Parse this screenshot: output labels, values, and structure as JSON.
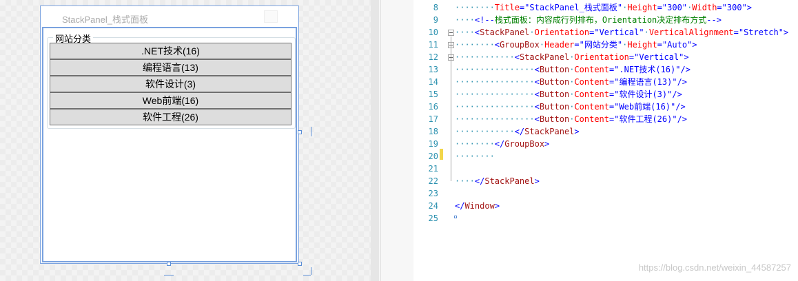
{
  "designer": {
    "window_title": "StackPanel_栈式面板",
    "group_header": "网站分类",
    "buttons": [
      ".NET技术(16)",
      "编程语言(13)",
      "软件设计(3)",
      "Web前端(16)",
      "软件工程(26)"
    ]
  },
  "editor": {
    "lines": [
      {
        "num": "8",
        "fold": "",
        "indent": "········",
        "parts": [
          [
            "attr",
            "Title"
          ],
          [
            "bracket",
            "=\""
          ],
          [
            "val",
            "StackPanel_栈式面板"
          ],
          [
            "bracket",
            "\""
          ],
          [
            "dots",
            "·"
          ],
          [
            "attr",
            "Height"
          ],
          [
            "bracket",
            "=\""
          ],
          [
            "val",
            "300"
          ],
          [
            "bracket",
            "\""
          ],
          [
            "dots",
            "·"
          ],
          [
            "attr",
            "Width"
          ],
          [
            "bracket",
            "=\""
          ],
          [
            "val",
            "300"
          ],
          [
            "bracket",
            "\">"
          ]
        ]
      },
      {
        "num": "9",
        "fold": "",
        "indent": "····",
        "parts": [
          [
            "bracket",
            "<!--"
          ],
          [
            "comment",
            "栈式面板：内容成行列排布，Orientation决定排布方式"
          ],
          [
            "bracket",
            "-->"
          ]
        ]
      },
      {
        "num": "10",
        "fold": "-",
        "indent": "····",
        "parts": [
          [
            "bracket",
            "<"
          ],
          [
            "tag",
            "StackPanel"
          ],
          [
            "dots",
            "·"
          ],
          [
            "attr",
            "Orientation"
          ],
          [
            "bracket",
            "=\""
          ],
          [
            "val",
            "Vertical"
          ],
          [
            "bracket",
            "\""
          ],
          [
            "dots",
            "·"
          ],
          [
            "attr",
            "VerticalAlignment"
          ],
          [
            "bracket",
            "=\""
          ],
          [
            "val",
            "Stretch"
          ],
          [
            "bracket",
            "\">"
          ]
        ]
      },
      {
        "num": "11",
        "fold": "-",
        "indent": "········",
        "parts": [
          [
            "bracket",
            "<"
          ],
          [
            "tag",
            "GroupBox"
          ],
          [
            "dots",
            "·"
          ],
          [
            "attr",
            "Header"
          ],
          [
            "bracket",
            "=\""
          ],
          [
            "val",
            "网站分类"
          ],
          [
            "bracket",
            "\""
          ],
          [
            "dots",
            "·"
          ],
          [
            "attr",
            "Height"
          ],
          [
            "bracket",
            "=\""
          ],
          [
            "val",
            "Auto"
          ],
          [
            "bracket",
            "\">"
          ]
        ]
      },
      {
        "num": "12",
        "fold": "-",
        "indent": "············",
        "parts": [
          [
            "bracket",
            "<"
          ],
          [
            "tag",
            "StackPanel"
          ],
          [
            "dots",
            "·"
          ],
          [
            "attr",
            "Orientation"
          ],
          [
            "bracket",
            "=\""
          ],
          [
            "val",
            "Vertical"
          ],
          [
            "bracket",
            "\">"
          ]
        ]
      },
      {
        "num": "13",
        "fold": "",
        "indent": "················",
        "parts": [
          [
            "bracket",
            "<"
          ],
          [
            "tag",
            "Button"
          ],
          [
            "dots",
            "·"
          ],
          [
            "attr",
            "Content"
          ],
          [
            "bracket",
            "=\""
          ],
          [
            "val",
            ".NET技术(16)"
          ],
          [
            "bracket",
            "\"/>"
          ]
        ]
      },
      {
        "num": "14",
        "fold": "",
        "indent": "················",
        "parts": [
          [
            "bracket",
            "<"
          ],
          [
            "tag",
            "Button"
          ],
          [
            "dots",
            "·"
          ],
          [
            "attr",
            "Content"
          ],
          [
            "bracket",
            "=\""
          ],
          [
            "val",
            "编程语言(13)"
          ],
          [
            "bracket",
            "\"/>"
          ]
        ]
      },
      {
        "num": "15",
        "fold": "",
        "indent": "················",
        "parts": [
          [
            "bracket",
            "<"
          ],
          [
            "tag",
            "Button"
          ],
          [
            "dots",
            "·"
          ],
          [
            "attr",
            "Content"
          ],
          [
            "bracket",
            "=\""
          ],
          [
            "val",
            "软件设计(3)"
          ],
          [
            "bracket",
            "\"/>"
          ]
        ]
      },
      {
        "num": "16",
        "fold": "",
        "indent": "················",
        "parts": [
          [
            "bracket",
            "<"
          ],
          [
            "tag",
            "Button"
          ],
          [
            "dots",
            "·"
          ],
          [
            "attr",
            "Content"
          ],
          [
            "bracket",
            "=\""
          ],
          [
            "val",
            "Web前端(16)"
          ],
          [
            "bracket",
            "\"/>"
          ]
        ]
      },
      {
        "num": "17",
        "fold": "",
        "indent": "················",
        "parts": [
          [
            "bracket",
            "<"
          ],
          [
            "tag",
            "Button"
          ],
          [
            "dots",
            "·"
          ],
          [
            "attr",
            "Content"
          ],
          [
            "bracket",
            "=\""
          ],
          [
            "val",
            "软件工程(26)"
          ],
          [
            "bracket",
            "\"/>"
          ]
        ]
      },
      {
        "num": "18",
        "fold": "",
        "indent": "············",
        "parts": [
          [
            "bracket",
            "</"
          ],
          [
            "tag",
            "StackPanel"
          ],
          [
            "bracket",
            ">"
          ]
        ]
      },
      {
        "num": "19",
        "fold": "",
        "indent": "········",
        "parts": [
          [
            "bracket",
            "</"
          ],
          [
            "tag",
            "GroupBox"
          ],
          [
            "bracket",
            ">"
          ]
        ]
      },
      {
        "num": "20",
        "fold": "",
        "indent": "········",
        "parts": []
      },
      {
        "num": "21",
        "fold": "",
        "indent": "",
        "parts": []
      },
      {
        "num": "22",
        "fold": "",
        "indent": "····",
        "parts": [
          [
            "bracket",
            "</"
          ],
          [
            "tag",
            "StackPanel"
          ],
          [
            "bracket",
            ">"
          ]
        ]
      },
      {
        "num": "23",
        "fold": "",
        "indent": "",
        "parts": []
      },
      {
        "num": "24",
        "fold": "",
        "indent": "",
        "parts": [
          [
            "bracket",
            "</"
          ],
          [
            "tag",
            "Window"
          ],
          [
            "bracket",
            ">"
          ]
        ]
      },
      {
        "num": "25",
        "fold": "",
        "indent": "",
        "parts": []
      }
    ],
    "watermark": "https://blog.csdn.net/weixin_44587257"
  }
}
